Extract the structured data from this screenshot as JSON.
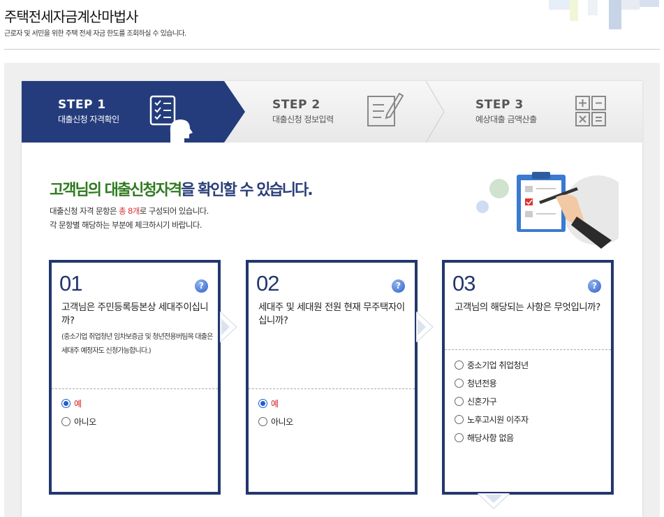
{
  "header": {
    "title": "주택전세자금계산마법사",
    "subtitle": "근로자 및 서민을 위한 주택 전세 자금 한도를 조회하실 수 있습니다."
  },
  "steps": [
    {
      "num": "STEP 1",
      "label": "대출신청 자격확인",
      "active": true,
      "icon": "checklist-person-icon"
    },
    {
      "num": "STEP 2",
      "label": "대출신청 정보입력",
      "active": false,
      "icon": "form-pencil-icon"
    },
    {
      "num": "STEP 3",
      "label": "예상대출 금액산출",
      "active": false,
      "icon": "calculator-icon"
    }
  ],
  "intro": {
    "title_green": "고객님의 대출신청자격",
    "title_blue": "을 확인할 수 있습니다.",
    "line1_pre": "대출신청 자격 문항은 ",
    "line1_em": "총 8개",
    "line1_post": "로 구성되어 있습니다.",
    "line2": "각 문항별 해당하는 부분에 체크하시기 바랍니다."
  },
  "questions": [
    {
      "num": "01",
      "text": "고객님은 주민등록등본상 세대주이십니까?",
      "note": "(중소기업 취업청년 임차보증금 및 청년전용버팀목 대출은 세대주 예정자도 신청가능합니다.)",
      "options": [
        {
          "label": "예",
          "checked": true
        },
        {
          "label": "아니오",
          "checked": false
        }
      ]
    },
    {
      "num": "02",
      "text": "세대주 및 세대원 전원 현재 무주택자이십니까?",
      "note": "",
      "options": [
        {
          "label": "예",
          "checked": true
        },
        {
          "label": "아니오",
          "checked": false
        }
      ]
    },
    {
      "num": "03",
      "text": "고객님의 해당되는 사항은 무엇입니까?",
      "note": "",
      "options": [
        {
          "label": "중소기업 취업청년",
          "checked": false
        },
        {
          "label": "청년전용",
          "checked": false
        },
        {
          "label": "신혼가구",
          "checked": false
        },
        {
          "label": "노후고시원 이주자",
          "checked": false
        },
        {
          "label": "해당사항 없음",
          "checked": false
        }
      ]
    }
  ],
  "help_symbol": "?",
  "colors": {
    "navy": "#243c7c",
    "green": "#2e7a1f",
    "red": "#d33"
  }
}
